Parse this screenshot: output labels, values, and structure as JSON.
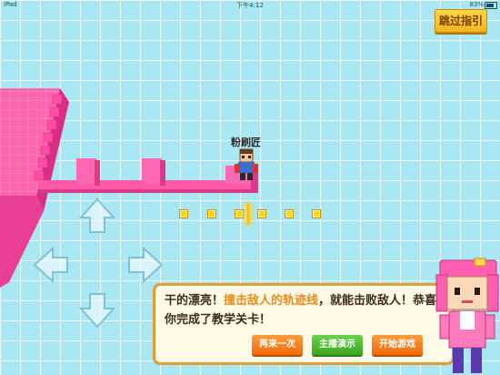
{
  "status_bar": {
    "carrier": "iPad",
    "time": "下午4:12",
    "battery": "83%"
  },
  "game": {
    "skip_button": "跳过指引",
    "player_name": "粉刷匠",
    "coin_count_visible": 6
  },
  "dialog": {
    "text_part1": "干的漂亮！",
    "text_highlight": "撞击敌人的轨迹线",
    "text_part2": "，就能击败敌人！恭喜你完成了教学关卡！",
    "buttons": {
      "retry": "再来一次",
      "demo": "主播演示",
      "start": "开始游戏"
    }
  },
  "colors": {
    "grid_bg": "#a9e7f3",
    "pink_block": "#ff5aa8",
    "coin": "#ffd21f",
    "dialog_border": "#e29b35",
    "highlight_text": "#f08a17"
  }
}
